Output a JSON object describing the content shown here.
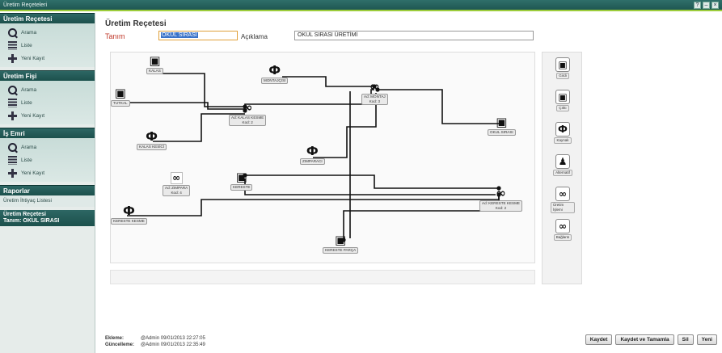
{
  "window": {
    "title": "Üretim Reçeteleri"
  },
  "sidebar": {
    "sections": [
      {
        "title": "Üretim Reçetesi",
        "items": [
          "Arama",
          "Liste",
          "Yeni Kayıt"
        ]
      },
      {
        "title": "Üretim Fişi",
        "items": [
          "Arama",
          "Liste",
          "Yeni Kayıt"
        ]
      },
      {
        "title": "İş Emri",
        "items": [
          "Arama",
          "Liste",
          "Yeni Kayıt"
        ]
      }
    ],
    "reports": {
      "title": "Raporlar",
      "item": "Üretim İhtiyaç Listesi"
    },
    "current": {
      "title": "Üretim Reçetesi",
      "subtitle": "Tanım: OKUL SIRASI"
    }
  },
  "form": {
    "title": "Üretim Reçetesi",
    "tanim_label": "Tanım",
    "tanim_value": "OKUL SIRASI",
    "aciklama_label": "Açıklama",
    "aciklama_value": "OKUL SIRASI ÜRETİMİ"
  },
  "diagram": {
    "nodes": [
      {
        "id": "kalas",
        "icon": "material-icon",
        "label": "KALAS"
      },
      {
        "id": "tutkal",
        "icon": "material-icon",
        "label": "TUTKAL"
      },
      {
        "id": "kalas_kesici",
        "icon": "resource-icon",
        "label": "KALAS KESİCİ"
      },
      {
        "id": "montajcisi",
        "icon": "resource-icon",
        "label": "MONTAJÇISI"
      },
      {
        "id": "kesim_op",
        "icon": "operation-icon",
        "label": "Ad: KALAS KESME\nKod: 2"
      },
      {
        "id": "montaj_op",
        "icon": "operation-icon",
        "label": "Ad: MONTAJ\nKod: 3"
      },
      {
        "id": "okul_sirasi",
        "icon": "material-icon",
        "label": "OKUL SIRASI"
      },
      {
        "id": "zimparaci",
        "icon": "resource-icon",
        "label": "ZIMPARACI"
      },
      {
        "id": "ara_op",
        "icon": "operation-icon",
        "label": "Ad: ZIMPARA\nKod: 4"
      },
      {
        "id": "kereste",
        "icon": "material-icon",
        "label": "KERESTE"
      },
      {
        "id": "kereste_kesme_res",
        "icon": "resource-icon",
        "label": "KERESTE KESME"
      },
      {
        "id": "kereste_op",
        "icon": "operation-icon",
        "label": "Ad: KERESTE KESME\nKod: 2"
      },
      {
        "id": "kereste_parca",
        "icon": "material-icon",
        "label": "KERESTE PARÇA"
      }
    ]
  },
  "palette": [
    {
      "icon": "material-icon",
      "label": "Girdi"
    },
    {
      "icon": "material-icon",
      "label": "Çıktı"
    },
    {
      "icon": "resource-icon",
      "label": "Kaynak"
    },
    {
      "icon": "chess-icon",
      "label": "Alternatif"
    },
    {
      "icon": "operation-icon",
      "label": "Üretim İşlemi"
    },
    {
      "icon": "link-icon",
      "label": "Bağlantı"
    }
  ],
  "audit": {
    "created_label": "Ekleme:",
    "created_value": "@Admin 09/01/2013 22:27:05",
    "updated_label": "Güncelleme:",
    "updated_value": "@Admin 09/01/2013 22:35:49"
  },
  "buttons": {
    "save": "Kaydet",
    "save_close": "Kaydet ve Tamamla",
    "delete": "Sil",
    "new": "Yeni"
  }
}
